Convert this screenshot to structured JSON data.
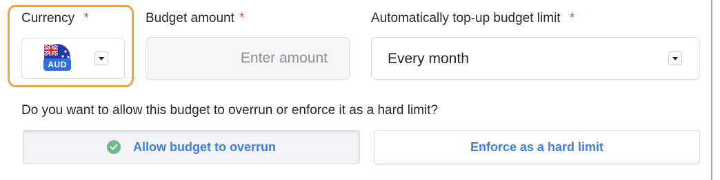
{
  "currency": {
    "label": "Currency",
    "required_mark": "*",
    "selected_code": "AUD",
    "flag_icon": "australia-flag-icon",
    "accent": "#f0a345"
  },
  "budget_amount": {
    "label": "Budget amount",
    "required_mark": "*",
    "value": "",
    "placeholder": "Enter amount"
  },
  "topup": {
    "label": "Automatically top-up budget limit",
    "required_mark": "*",
    "selected": "Every month"
  },
  "overrun": {
    "question": "Do you want to allow this budget to overrun or enforce it as a hard limit?",
    "options": [
      {
        "label": "Allow budget to overrun",
        "selected": true,
        "icon": "check-circle-icon"
      },
      {
        "label": "Enforce as a hard limit",
        "selected": false
      }
    ]
  },
  "colors": {
    "required": "#e14b4b",
    "link_blue": "#3d7fdc",
    "check_green": "#6fb889"
  }
}
